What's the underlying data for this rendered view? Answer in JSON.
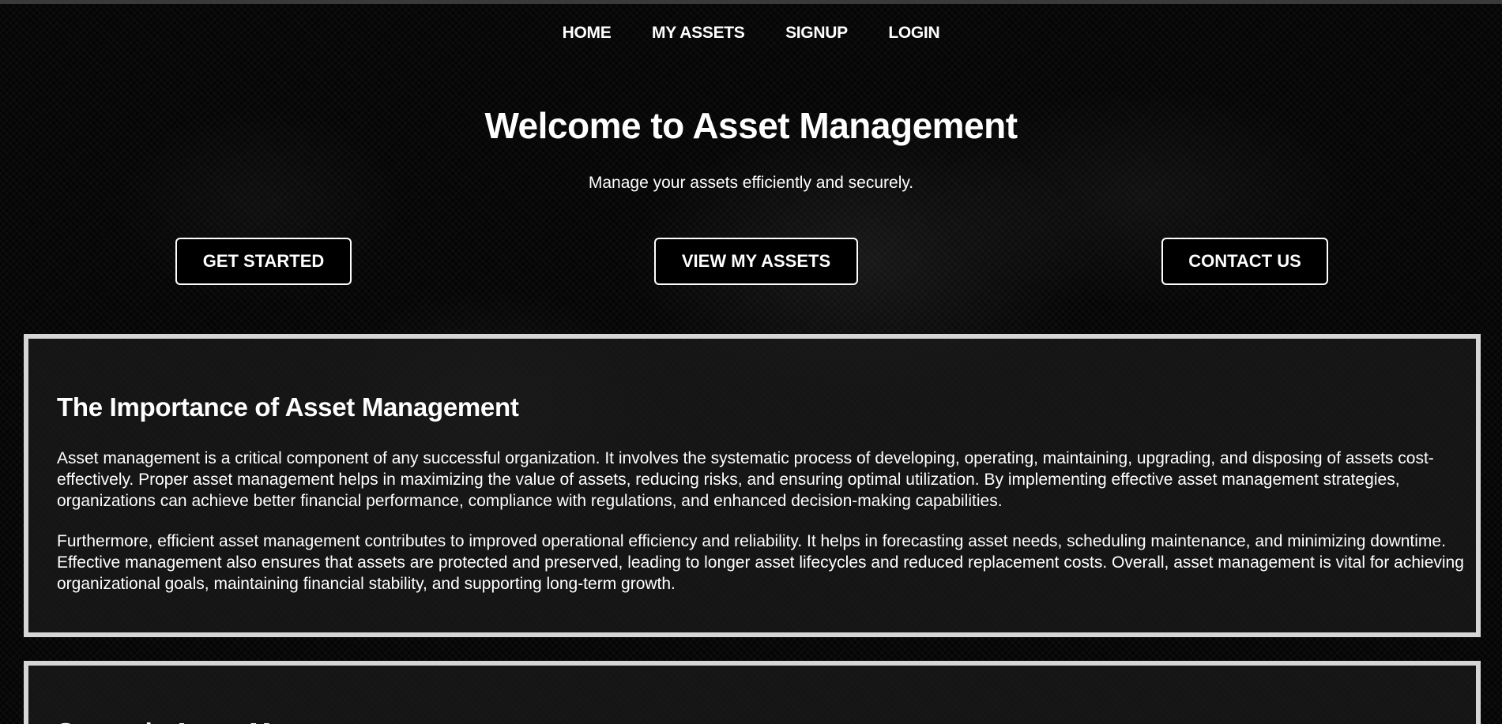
{
  "nav": {
    "items": [
      {
        "label": "HOME"
      },
      {
        "label": "MY ASSETS"
      },
      {
        "label": "SIGNUP"
      },
      {
        "label": "LOGIN"
      }
    ]
  },
  "hero": {
    "title": "Welcome to Asset Management",
    "subtitle": "Manage your assets efficiently and securely."
  },
  "cta": {
    "get_started": "GET STARTED",
    "view_assets": "VIEW MY ASSETS",
    "contact": "CONTACT US"
  },
  "sections": [
    {
      "heading": "The Importance of Asset Management",
      "paragraphs": [
        "Asset management is a critical component of any successful organization. It involves the systematic process of developing, operating, maintaining, upgrading, and disposing of assets cost-effectively. Proper asset management helps in maximizing the value of assets, reducing risks, and ensuring optimal utilization. By implementing effective asset management strategies, organizations can achieve better financial performance, compliance with regulations, and enhanced decision-making capabilities.",
        "Furthermore, efficient asset management contributes to improved operational efficiency and reliability. It helps in forecasting asset needs, scheduling maintenance, and minimizing downtime. Effective management also ensures that assets are protected and preserved, leading to longer asset lifecycles and reduced replacement costs. Overall, asset management is vital for achieving organizational goals, maintaining financial stability, and supporting long-term growth."
      ]
    },
    {
      "heading": "Strategic Asset Management"
    }
  ],
  "colors": {
    "background": "#050505",
    "text": "#ffffff",
    "panel_border": "#d6d6d6",
    "button_border": "#ffffff"
  }
}
